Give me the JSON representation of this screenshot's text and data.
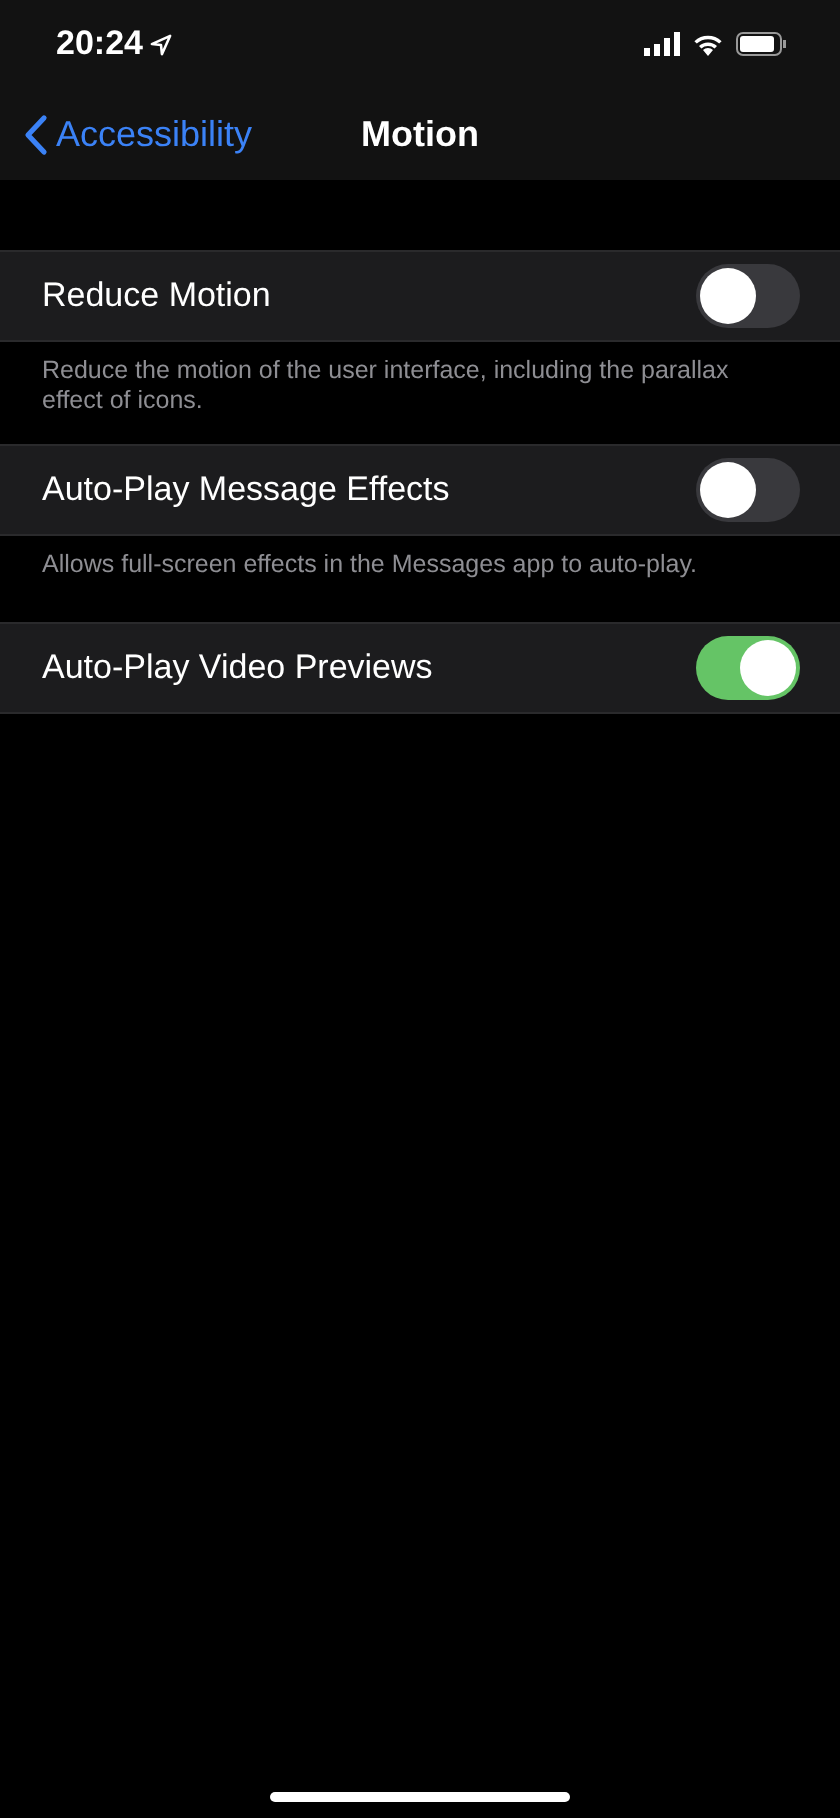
{
  "status_bar": {
    "time": "20:24"
  },
  "nav": {
    "back": "Accessibility",
    "title": "Motion"
  },
  "settings": [
    {
      "label": "Reduce Motion",
      "on": false,
      "footer": "Reduce the motion of the user interface, including the parallax effect of icons."
    },
    {
      "label": "Auto-Play Message Effects",
      "on": false,
      "footer": "Allows full-screen effects in the Messages app to auto-play."
    },
    {
      "label": "Auto-Play Video Previews",
      "on": true
    }
  ]
}
